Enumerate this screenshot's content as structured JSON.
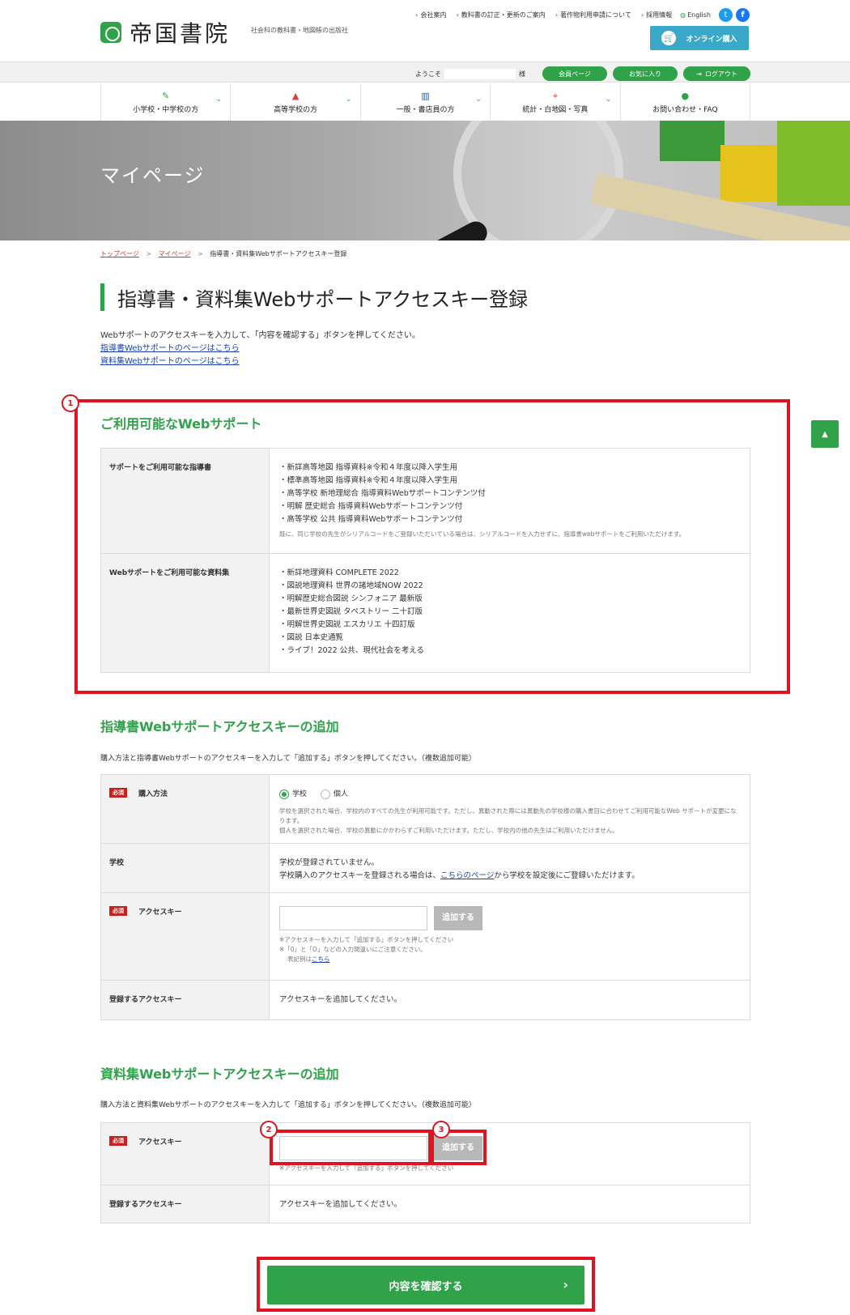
{
  "header": {
    "logo_text": "帝国書院",
    "tagline": "社会科の教科書・地図帳の出版社",
    "top_links": [
      "会社案内",
      "教科書の訂正・更新のご案内",
      "著作物利用申請について",
      "採用情報"
    ],
    "english": "English",
    "online_purchase": "オンライン購入"
  },
  "member_bar": {
    "welcome": "ようこそ",
    "honorific": "様",
    "member_page": "会員ページ",
    "favorites": "お気に入り",
    "logout": "ログアウト"
  },
  "nav": [
    {
      "label": "小学校・中学校の方",
      "icon": "pencil-icon",
      "glyph": "✎"
    },
    {
      "label": "高等学校の方",
      "icon": "graduation-cap-icon",
      "glyph": "🎓"
    },
    {
      "label": "一般・書店員の方",
      "icon": "books-icon",
      "glyph": "▥"
    },
    {
      "label": "統計・白地図・写真",
      "icon": "map-pin-icon",
      "glyph": "⌖"
    },
    {
      "label": "お問い合わせ・FAQ",
      "icon": "chat-icon",
      "glyph": "●"
    }
  ],
  "hero": {
    "title": "マイページ"
  },
  "breadcrumb": {
    "home": "トップページ",
    "mypage": "マイページ",
    "current": "指導書・資料集Webサポートアクセスキー登録",
    "sep": ">"
  },
  "page_title": "指導書・資料集Webサポートアクセスキー登録",
  "intro": {
    "text": "Webサポートのアクセスキーを入力して、「内容を確認する」ボタンを押してください。",
    "link1": "指導書Webサポートのページはこちら",
    "link2": "資料集Webサポートのページはこちら"
  },
  "available": {
    "heading": "ご利用可能なWebサポート",
    "guide_label": "サポートをご利用可能な指導書",
    "guides": [
      "・新詳高等地図 指導資料※令和４年度以降入学生用",
      "・標準高等地図 指導資料※令和４年度以降入学生用",
      "・高等学校 新地理総合 指導資料Webサポートコンテンツ付",
      "・明解 歴史総合 指導資料Webサポートコンテンツ付",
      "・高等学校 公共 指導資料Webサポートコンテンツ付"
    ],
    "guide_note": "既に、同じ学校の先生がシリアルコードをご登録いただいている場合は、シリアルコードを入力せずに、指導書webサポートをご利用いただけます。",
    "material_label": "Webサポートをご利用可能な資料集",
    "materials": [
      "・新詳地理資料 COMPLETE 2022",
      "・図説地理資料 世界の諸地域NOW 2022",
      "・明解歴史総合図説 シンフォニア 最新版",
      "・最新世界史図説 タペストリー 二十訂版",
      "・明解世界史図説 エスカリエ 十四訂版",
      "・図説 日本史通覧",
      "・ライブ！2022 公共、現代社会を考える"
    ]
  },
  "guide_section": {
    "heading": "指導書Webサポートアクセスキーの追加",
    "desc": "購入方法と指導書Webサポートのアクセスキーを入力して「追加する」ボタンを押してください。（複数追加可能）",
    "required": "必須",
    "purchase_label": "購入方法",
    "opt_school": "学校",
    "opt_personal": "個人",
    "purchase_note1": "学校を選択された場合、学校内のすべての先生が利用可能です。ただし、異動された際には異動先の学校様の購入書目に合わせてご利用可能なWeb サポートが変更になります。",
    "purchase_note2": "個人を選択された場合、学校の異動にかかわらずご利用いただけます。ただし、学校内の他の先生はご利用いただけません。",
    "school_label": "学校",
    "school_msg1": "学校が登録されていません。",
    "school_msg2a": "学校購入のアクセスキーを登録される場合は、",
    "school_msg2_link": "こちらのページ",
    "school_msg2b": "から学校を設定後にご登録いただけます。",
    "key_label": "アクセスキー",
    "add_btn": "追加する",
    "key_note1": "※アクセスキーを入力して「追加する」ボタンを押してください",
    "key_note2": "※「0」と「O」などの入力間違いにご注意ください。",
    "key_note3a": "表記例は",
    "key_note3_link": "こちら",
    "registered_label": "登録するアクセスキー",
    "registered_msg": "アクセスキーを追加してください。"
  },
  "material_section": {
    "heading": "資料集Webサポートアクセスキーの追加",
    "desc": "購入方法と資料集Webサポートのアクセスキーを入力して「追加する」ボタンを押してください。（複数追加可能）",
    "required": "必須",
    "key_label": "アクセスキー",
    "add_btn": "追加する",
    "key_note1": "※アクセスキーを入力して「追加する」ボタンを押してください",
    "registered_label": "登録するアクセスキー",
    "registered_msg": "アクセスキーを追加してください。"
  },
  "callouts": [
    "1",
    "2",
    "3"
  ],
  "to_top": "▲",
  "confirm_btn": "内容を確認する",
  "confirm_arrow": "›",
  "colors": {
    "brand_green": "#2fa24a",
    "highlight_red": "#e0141e",
    "required_red": "#c91f1f",
    "accent_blue": "#3aa8c9"
  }
}
